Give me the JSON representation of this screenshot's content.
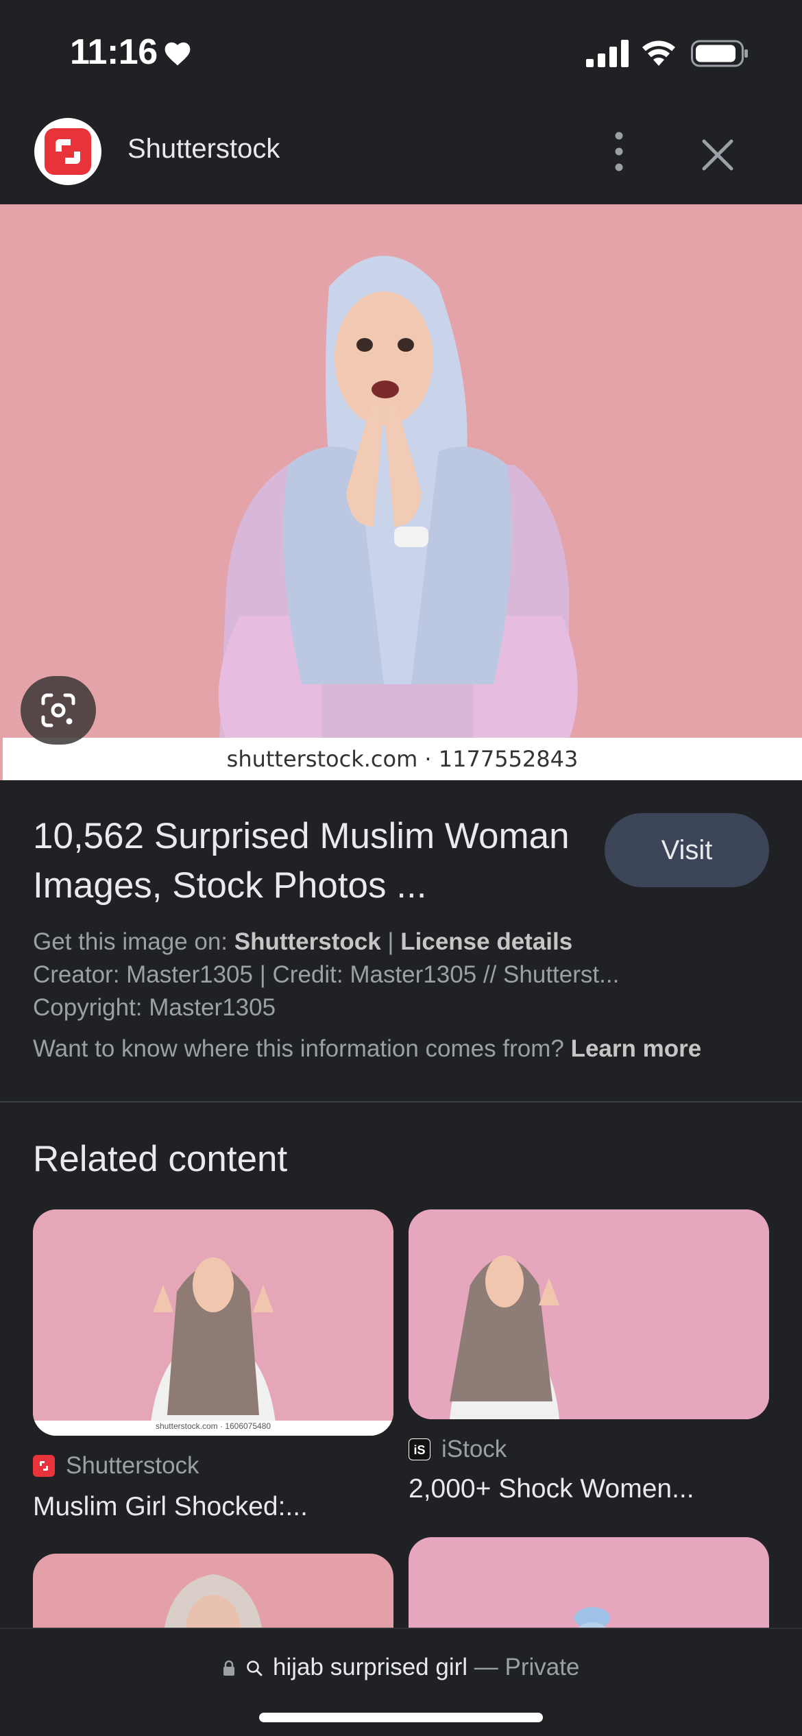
{
  "status_bar": {
    "time": "11:16"
  },
  "header": {
    "site_name": "Shutterstock",
    "logo_color": "#e8333a"
  },
  "hero": {
    "caption": "shutterstock.com · 1177552843",
    "background_color": "#e4a3a8"
  },
  "info": {
    "title": "10,562 Surprised Muslim Woman Images, Stock Photos ...",
    "visit_label": "Visit",
    "get_image_prefix": "Get this image on: ",
    "get_image_source": "Shutterstock",
    "separator": " | ",
    "license_label": "License details",
    "creator_line": "Creator: Master1305 | Credit: Master1305 // Shutterst...",
    "copyright_line": "Copyright: Master1305",
    "info_question": "Want to know where this information comes from? ",
    "learn_more": "Learn more"
  },
  "related": {
    "heading": "Related content",
    "items": [
      {
        "source": "Shutterstock",
        "title": "Muslim Girl Shocked:...",
        "image_caption": "shutterstock.com · 1606075480",
        "icon": "shutterstock-icon"
      },
      {
        "source": "iStock",
        "title": "2,000+ Shock Women...",
        "icon": "istock-icon"
      }
    ]
  },
  "bottom_bar": {
    "query": "hijab surprised girl",
    "private_label": "— Private"
  }
}
